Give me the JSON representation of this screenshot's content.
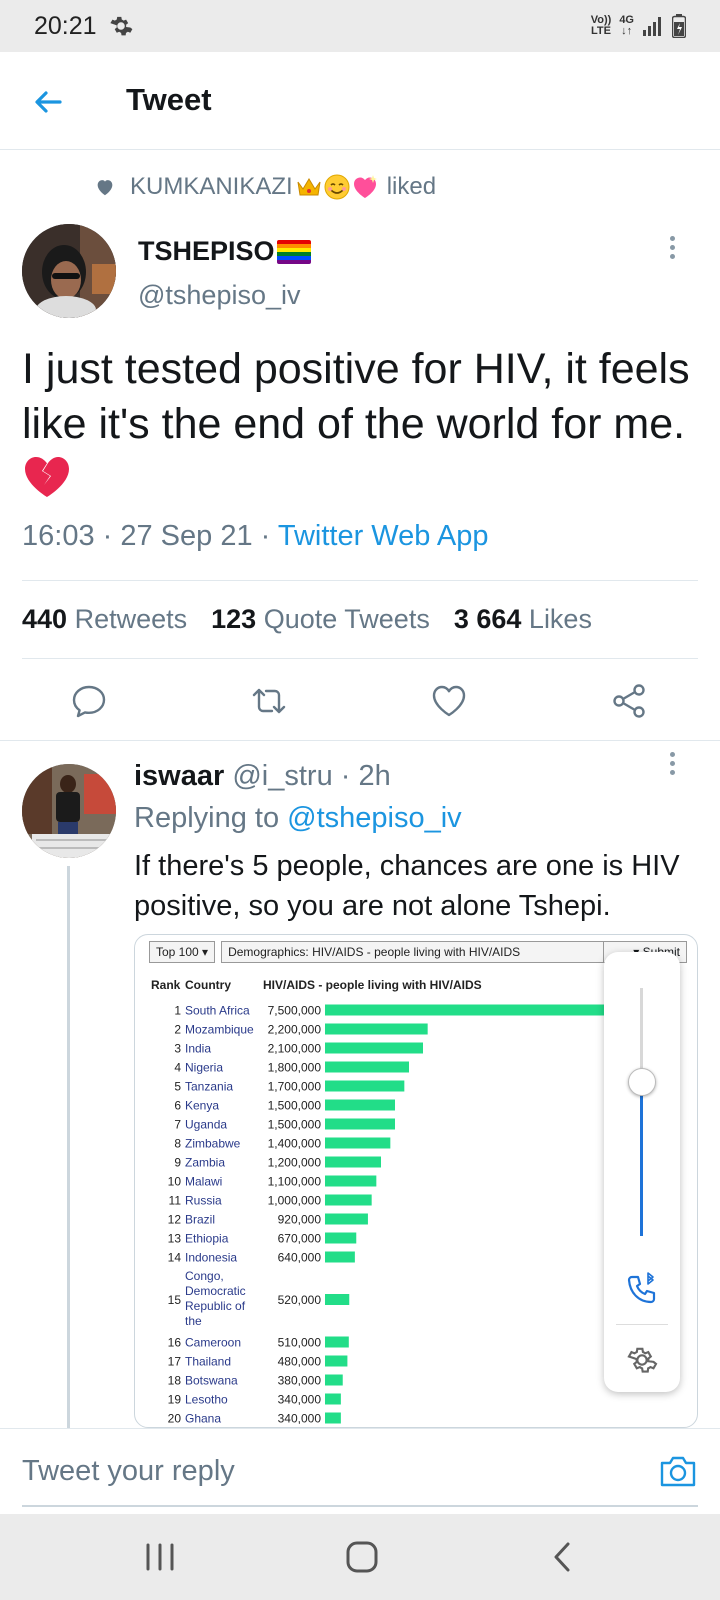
{
  "status_bar": {
    "time": "20:21",
    "vol": "Vo))",
    "lte": "LTE",
    "net": "4G"
  },
  "header": {
    "title": "Tweet"
  },
  "liked": {
    "name": "KUMKANIKAZI",
    "suffix": "liked"
  },
  "tweet": {
    "author_name": "TSHEPISO",
    "author_handle": "@tshepiso_iv",
    "text": "I just tested positive for HIV, it feels like it's the end of the world for me.",
    "time": "16:03 · 27 Sep 21 · ",
    "source": "Twitter Web App",
    "stats": {
      "retweets_count": "440",
      "retweets_label": "Retweets",
      "quotes_count": "123",
      "quotes_label": "Quote Tweets",
      "likes_count": "3 664",
      "likes_label": "Likes"
    }
  },
  "reply": {
    "name": "iswaar",
    "handle_time": " @i_stru · 2h",
    "replying_prefix": "Replying to ",
    "replying_to": "@tshepiso_iv",
    "text": "If there's 5 people, chances are one is HIV positive, so you are not alone Tshepi."
  },
  "embedded_chart_toolbar": {
    "top": "Top 100 ▾",
    "dataset": "Demographics: HIV/AIDS - people living with HIV/AIDS",
    "submit": "▾   Submit"
  },
  "chart_data": {
    "type": "bar",
    "orientation": "horizontal",
    "columns": [
      "Rank",
      "Country",
      "HIV/AIDS - people living with HIV/AIDS"
    ],
    "ranks": [
      1,
      2,
      3,
      4,
      5,
      6,
      7,
      8,
      9,
      10,
      11,
      12,
      13,
      14,
      15,
      16,
      17,
      18,
      19,
      20
    ],
    "categories": [
      "South Africa",
      "Mozambique",
      "India",
      "Nigeria",
      "Tanzania",
      "Kenya",
      "Uganda",
      "Zimbabwe",
      "Zambia",
      "Malawi",
      "Russia",
      "Brazil",
      "Ethiopia",
      "Indonesia",
      "Congo, Democratic Republic of the",
      "Cameroon",
      "Thailand",
      "Botswana",
      "Lesotho",
      "Ghana"
    ],
    "values": [
      7500000,
      2200000,
      2100000,
      1800000,
      1700000,
      1500000,
      1500000,
      1400000,
      1200000,
      1100000,
      1000000,
      920000,
      670000,
      640000,
      520000,
      510000,
      480000,
      380000,
      340000,
      340000
    ],
    "value_labels": [
      "7,500,000",
      "2,200,000",
      "2,100,000",
      "1,800,000",
      "1,700,000",
      "1,500,000",
      "1,500,000",
      "1,400,000",
      "1,200,000",
      "1,100,000",
      "1,000,000",
      "920,000",
      "670,000",
      "640,000",
      "520,000",
      "510,000",
      "480,000",
      "380,000",
      "340,000",
      "340,000"
    ],
    "bar_color": "#22dd88"
  },
  "volume_level": 0.62,
  "reply_box": {
    "placeholder": "Tweet your reply"
  },
  "colors": {
    "accent": "#1b95e0",
    "muted": "#657786",
    "text": "#14171a"
  }
}
